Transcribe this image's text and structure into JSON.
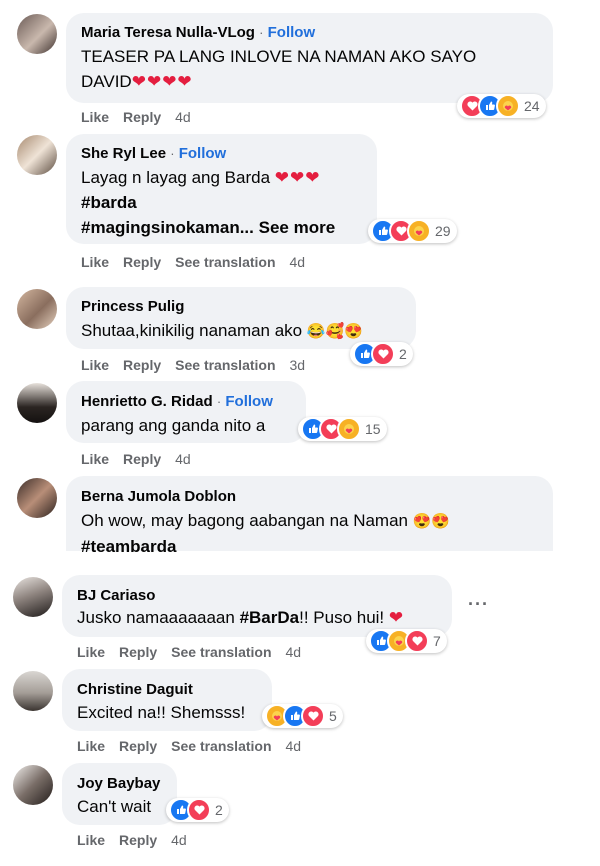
{
  "comments": [
    {
      "author": "Maria Teresa Nulla-VLog",
      "follow": "Follow",
      "line1": "TEASER PA LANG INLOVE NA NAMAN AKO SAYO",
      "line2": "DAVID",
      "hearts": "❤❤❤❤",
      "reaction_count": "24",
      "like": "Like",
      "reply": "Reply",
      "time": "4d"
    },
    {
      "author": "She Ryl Lee",
      "follow": "Follow",
      "line1": "Layag n layag ang Barda",
      "hearts": "❤❤❤",
      "line2": "#barda",
      "line3": "#magingsinokaman... ",
      "see_more": "See more",
      "reaction_count": "29",
      "like": "Like",
      "reply": "Reply",
      "see_translation": "See translation",
      "time": "4d"
    },
    {
      "author": "Princess Pulig",
      "line1": "Shutaa,kinikilig nanaman ako",
      "emojis": "😂🥰😍",
      "reaction_count": "2",
      "like": "Like",
      "reply": "Reply",
      "see_translation": "See translation",
      "time": "3d"
    },
    {
      "author": "Henrietto G. Ridad",
      "follow": "Follow",
      "line1": "parang ang ganda nito a",
      "reaction_count": "15",
      "like": "Like",
      "reply": "Reply",
      "time": "4d"
    },
    {
      "author": "Berna Jumola Doblon",
      "line1": "Oh wow, may bagong aabangan na Naman",
      "emojis": "😍😍",
      "line2": "#teambarda"
    },
    {
      "author": "BJ Cariaso",
      "line1_pre": "Jusko namaaaaaaan ",
      "line1_tag": "#BarDa",
      "line1_post": "!! Puso hui!",
      "hearts": "❤",
      "reaction_count": "7",
      "like": "Like",
      "reply": "Reply",
      "see_translation": "See translation",
      "time": "4d"
    },
    {
      "author": "Christine Daguit",
      "line1": "Excited na!! Shemsss!",
      "reaction_count": "5",
      "like": "Like",
      "reply": "Reply",
      "see_translation": "See translation",
      "time": "4d"
    },
    {
      "author": "Joy Baybay",
      "line1": "Can't wait",
      "reaction_count": "2",
      "like": "Like",
      "reply": "Reply",
      "time": "4d"
    }
  ],
  "more_options": "···",
  "colors": {
    "follow": "#216fdb",
    "bubble": "#f0f2f5",
    "meta": "#65676b",
    "like": "#1877f2",
    "love": "#f33e58",
    "care": "#f7b125"
  }
}
